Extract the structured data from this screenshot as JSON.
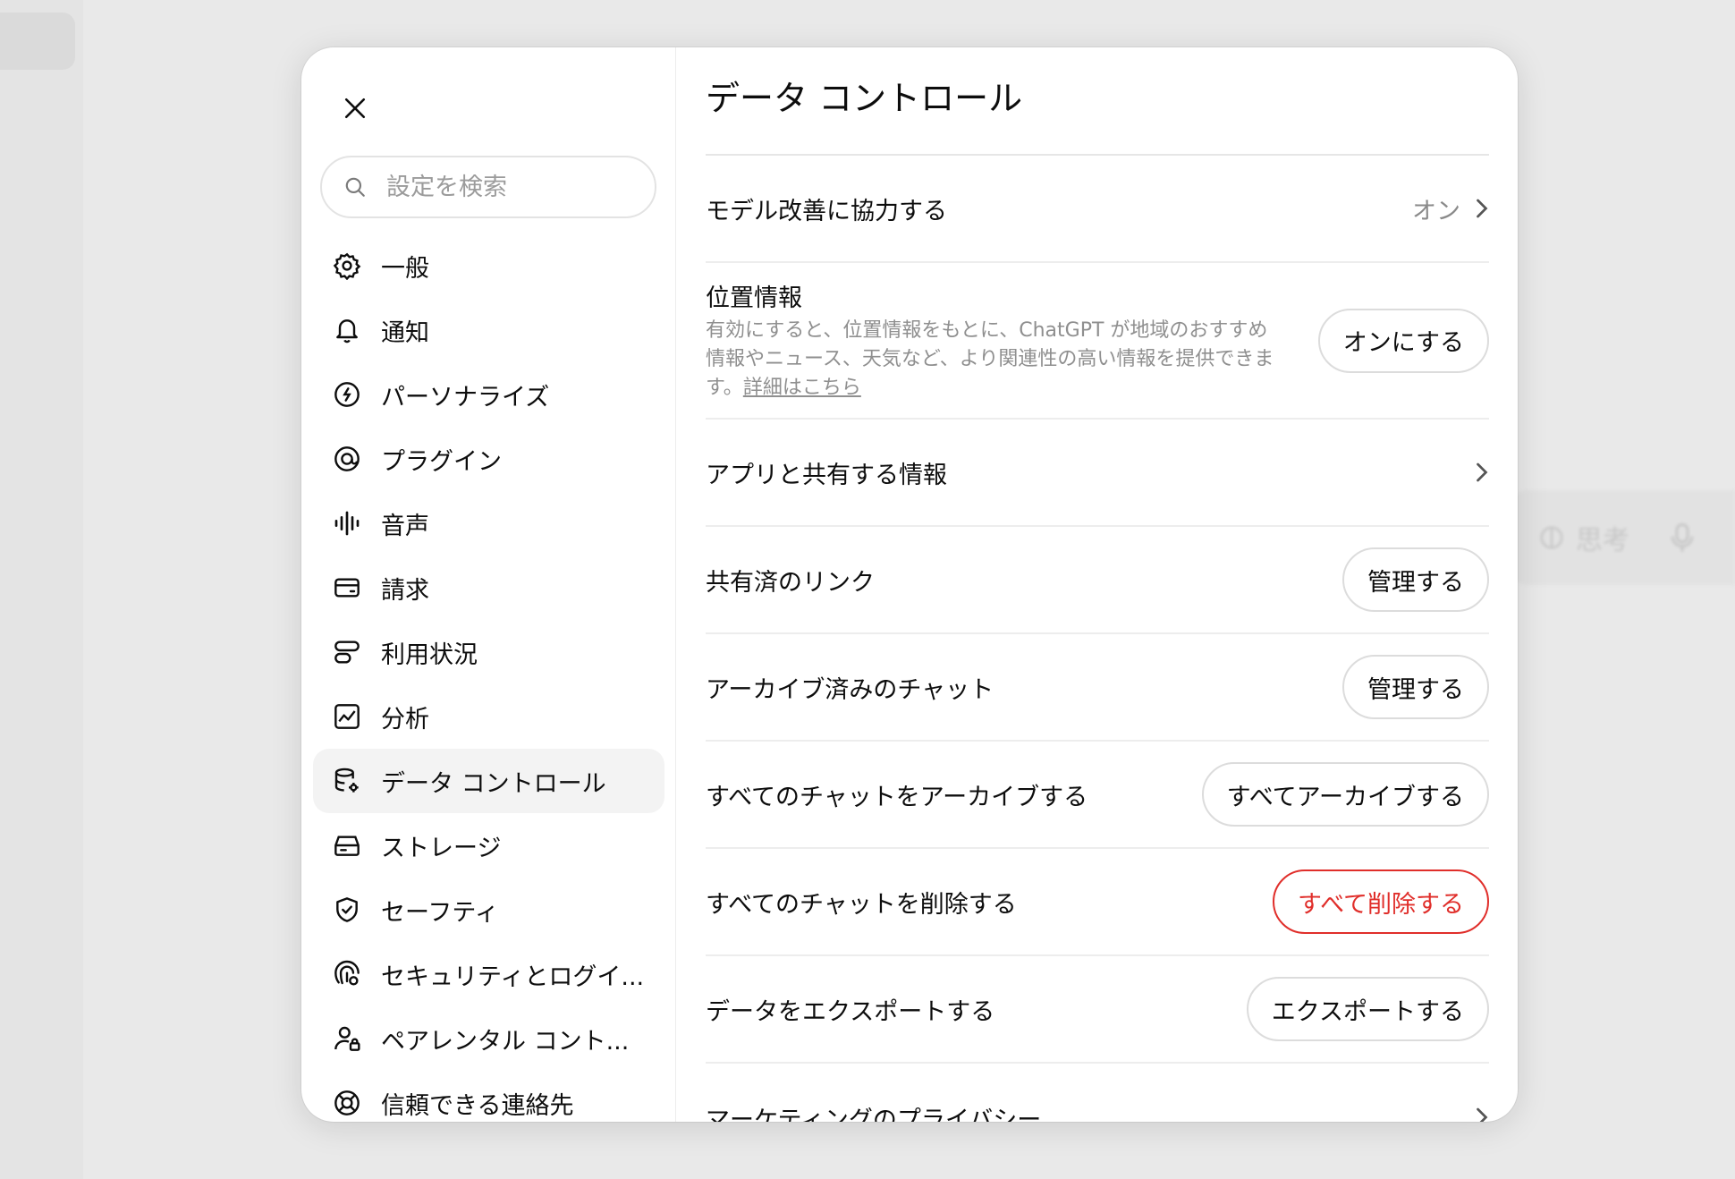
{
  "background": {
    "composer": {
      "think_label": "思考"
    }
  },
  "sidebar": {
    "search_placeholder": "設定を検索",
    "items": [
      {
        "label": "一般",
        "icon": "gear-icon"
      },
      {
        "label": "通知",
        "icon": "bell-icon"
      },
      {
        "label": "パーソナライズ",
        "icon": "personalize-icon"
      },
      {
        "label": "プラグイン",
        "icon": "plugin-icon"
      },
      {
        "label": "音声",
        "icon": "waveform-icon"
      },
      {
        "label": "請求",
        "icon": "card-icon"
      },
      {
        "label": "利用状況",
        "icon": "usage-icon"
      },
      {
        "label": "分析",
        "icon": "chart-icon"
      },
      {
        "label": "データ コントロール",
        "icon": "database-gear-icon",
        "active": true
      },
      {
        "label": "ストレージ",
        "icon": "storage-icon"
      },
      {
        "label": "セーフティ",
        "icon": "shield-check-icon"
      },
      {
        "label": "セキュリティとログイ...",
        "icon": "security-icon"
      },
      {
        "label": "ペアレンタル コント...",
        "icon": "parental-icon"
      },
      {
        "label": "信頼できる連絡先",
        "icon": "lifebuoy-icon"
      }
    ]
  },
  "main": {
    "title": "データ コントロール",
    "model_improve": {
      "label": "モデル改善に協力する",
      "value": "オン"
    },
    "location": {
      "label": "位置情報",
      "description": "有効にすると、位置情報をもとに、ChatGPT が地域のおすすめ情報やニュース、天気など、より関連性の高い情報を提供できます。",
      "link": "詳細はこちら",
      "button": "オンにする"
    },
    "app_share": {
      "label": "アプリと共有する情報"
    },
    "shared_links": {
      "label": "共有済のリンク",
      "button": "管理する"
    },
    "archived": {
      "label": "アーカイブ済みのチャット",
      "button": "管理する"
    },
    "archive_all": {
      "label": "すべてのチャットをアーカイブする",
      "button": "すべてアーカイブする"
    },
    "delete_all": {
      "label": "すべてのチャットを削除する",
      "button": "すべて削除する"
    },
    "export": {
      "label": "データをエクスポートする",
      "button": "エクスポートする"
    },
    "marketing": {
      "label": "マーケティングのプライバシー"
    }
  },
  "colors": {
    "danger": "#e02e2a",
    "divider": "#ededed",
    "active_bg": "#f3f3f3"
  }
}
